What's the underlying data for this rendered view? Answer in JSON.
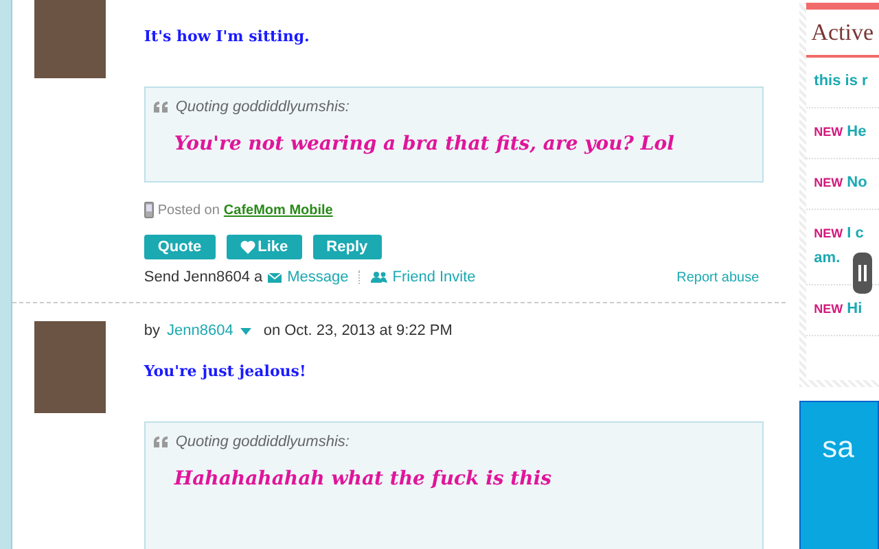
{
  "posts": [
    {
      "body": "It's how I'm sitting.",
      "quote": {
        "label": "Quoting goddiddlyumshis:",
        "text": "You're not wearing a bra that fits, are you? Lol"
      },
      "posted_on": {
        "prefix": "Posted on",
        "link": "CafeMom Mobile"
      },
      "buttons": [
        "Quote",
        "Like",
        "Reply"
      ],
      "send": {
        "prefix": "Send Jenn8604 a",
        "message": "Message",
        "invite": "Friend Invite",
        "report": "Report abuse"
      }
    },
    {
      "byline": {
        "by": "by",
        "user": "Jenn8604",
        "date": "on Oct. 23, 2013 at 9:22 PM"
      },
      "body": "You're just jealous!",
      "quote": {
        "label": "Quoting goddiddlyumshis:",
        "text": "Hahahahahah what the fuck is this"
      }
    }
  ],
  "sidebar": {
    "title": "Active",
    "items": [
      {
        "is_new": false,
        "text": "this is r"
      },
      {
        "is_new": true,
        "badge": "NEW",
        "text": "He"
      },
      {
        "is_new": true,
        "badge": "NEW",
        "text": "No"
      },
      {
        "is_new": true,
        "badge": "NEW",
        "text": "I c",
        "text2": "am."
      },
      {
        "is_new": true,
        "badge": "NEW",
        "text": "Hi"
      }
    ]
  },
  "ad": {
    "text": "sa"
  }
}
